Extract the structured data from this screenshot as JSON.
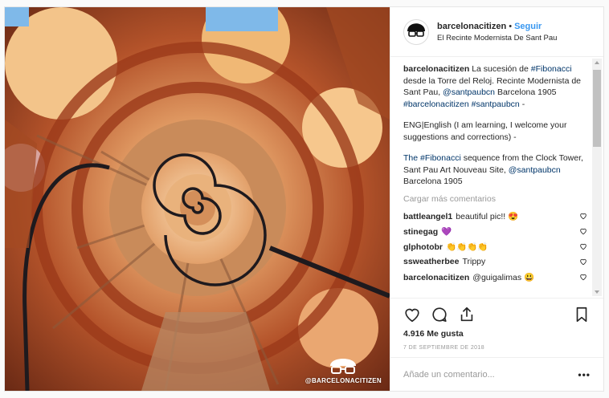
{
  "post": {
    "username": "barcelonacitizen",
    "dot": "•",
    "follow_label": "Seguir",
    "location": "El Recinte Modernista De Sant Pau",
    "watermark": "@BARCELONACITIZEN",
    "colors": {
      "accent": "#3897f0",
      "hashtag": "#003569",
      "muted": "#999999"
    }
  },
  "caption": {
    "username": "barcelonacitizen",
    "p1_a": "La sucesión de",
    "p1_tag1": "#Fibonacci",
    "p1_b": "desde la Torre del Reloj. Recinte Modernista de Sant Pau,",
    "p1_mention": "@santpaubcn",
    "p1_c": "Barcelona 1905",
    "p1_tag2": "#barcelonacitizen",
    "p1_tag3": "#santpaubcn",
    "p1_d": "-",
    "p2": "ENG|English (I am learning, I welcome your suggestions and corrections) -",
    "p3_tag": "The #Fibonacci",
    "p3_a": "sequence from the Clock Tower, Sant Pau Art Nouveau Site,",
    "p3_mention": "@santpaubcn",
    "p3_b": "Barcelona 1905"
  },
  "load_more": "Cargar más comentarios",
  "comments": [
    {
      "user": "battleangel1",
      "text": "beautiful pic!! 😍"
    },
    {
      "user": "stinegag",
      "text": "💜"
    },
    {
      "user": "glphotobr",
      "text": "👏👏👏👏"
    },
    {
      "user": "ssweatherbee",
      "text": "Trippy"
    },
    {
      "user": "barcelonacitizen",
      "text": "@guigalimas 😃"
    }
  ],
  "icons": {
    "like": "heart-icon",
    "comment": "comment-icon",
    "share": "share-icon",
    "save": "bookmark-icon",
    "options": "more-options-icon"
  },
  "likes": "4.916 Me gusta",
  "date": "7 DE SEPTIEMBRE DE 2018",
  "add_comment_placeholder": "Añade un comentario...",
  "options_label": "•••"
}
